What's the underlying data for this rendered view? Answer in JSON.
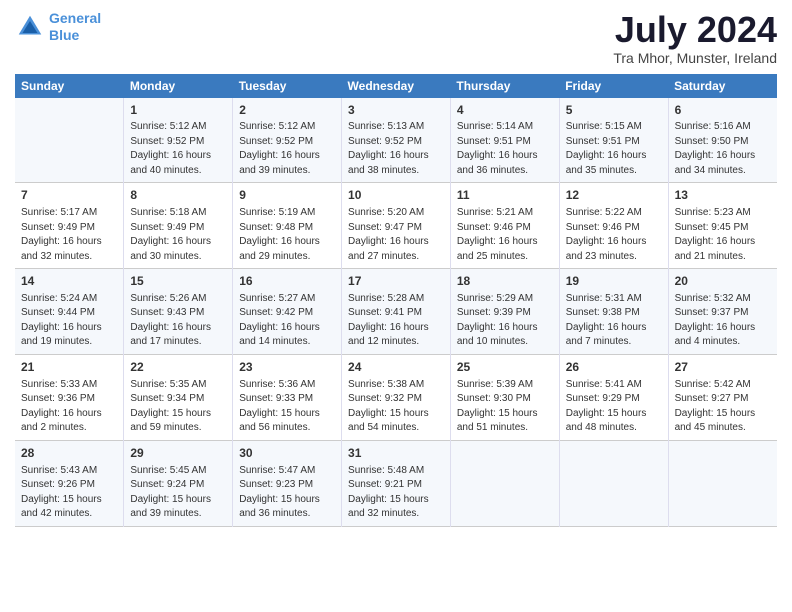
{
  "logo": {
    "line1": "General",
    "line2": "Blue"
  },
  "title": "July 2024",
  "subtitle": "Tra Mhor, Munster, Ireland",
  "days_header": [
    "Sunday",
    "Monday",
    "Tuesday",
    "Wednesday",
    "Thursday",
    "Friday",
    "Saturday"
  ],
  "weeks": [
    [
      {
        "day": "",
        "info": ""
      },
      {
        "day": "1",
        "info": "Sunrise: 5:12 AM\nSunset: 9:52 PM\nDaylight: 16 hours\nand 40 minutes."
      },
      {
        "day": "2",
        "info": "Sunrise: 5:12 AM\nSunset: 9:52 PM\nDaylight: 16 hours\nand 39 minutes."
      },
      {
        "day": "3",
        "info": "Sunrise: 5:13 AM\nSunset: 9:52 PM\nDaylight: 16 hours\nand 38 minutes."
      },
      {
        "day": "4",
        "info": "Sunrise: 5:14 AM\nSunset: 9:51 PM\nDaylight: 16 hours\nand 36 minutes."
      },
      {
        "day": "5",
        "info": "Sunrise: 5:15 AM\nSunset: 9:51 PM\nDaylight: 16 hours\nand 35 minutes."
      },
      {
        "day": "6",
        "info": "Sunrise: 5:16 AM\nSunset: 9:50 PM\nDaylight: 16 hours\nand 34 minutes."
      }
    ],
    [
      {
        "day": "7",
        "info": "Sunrise: 5:17 AM\nSunset: 9:49 PM\nDaylight: 16 hours\nand 32 minutes."
      },
      {
        "day": "8",
        "info": "Sunrise: 5:18 AM\nSunset: 9:49 PM\nDaylight: 16 hours\nand 30 minutes."
      },
      {
        "day": "9",
        "info": "Sunrise: 5:19 AM\nSunset: 9:48 PM\nDaylight: 16 hours\nand 29 minutes."
      },
      {
        "day": "10",
        "info": "Sunrise: 5:20 AM\nSunset: 9:47 PM\nDaylight: 16 hours\nand 27 minutes."
      },
      {
        "day": "11",
        "info": "Sunrise: 5:21 AM\nSunset: 9:46 PM\nDaylight: 16 hours\nand 25 minutes."
      },
      {
        "day": "12",
        "info": "Sunrise: 5:22 AM\nSunset: 9:46 PM\nDaylight: 16 hours\nand 23 minutes."
      },
      {
        "day": "13",
        "info": "Sunrise: 5:23 AM\nSunset: 9:45 PM\nDaylight: 16 hours\nand 21 minutes."
      }
    ],
    [
      {
        "day": "14",
        "info": "Sunrise: 5:24 AM\nSunset: 9:44 PM\nDaylight: 16 hours\nand 19 minutes."
      },
      {
        "day": "15",
        "info": "Sunrise: 5:26 AM\nSunset: 9:43 PM\nDaylight: 16 hours\nand 17 minutes."
      },
      {
        "day": "16",
        "info": "Sunrise: 5:27 AM\nSunset: 9:42 PM\nDaylight: 16 hours\nand 14 minutes."
      },
      {
        "day": "17",
        "info": "Sunrise: 5:28 AM\nSunset: 9:41 PM\nDaylight: 16 hours\nand 12 minutes."
      },
      {
        "day": "18",
        "info": "Sunrise: 5:29 AM\nSunset: 9:39 PM\nDaylight: 16 hours\nand 10 minutes."
      },
      {
        "day": "19",
        "info": "Sunrise: 5:31 AM\nSunset: 9:38 PM\nDaylight: 16 hours\nand 7 minutes."
      },
      {
        "day": "20",
        "info": "Sunrise: 5:32 AM\nSunset: 9:37 PM\nDaylight: 16 hours\nand 4 minutes."
      }
    ],
    [
      {
        "day": "21",
        "info": "Sunrise: 5:33 AM\nSunset: 9:36 PM\nDaylight: 16 hours\nand 2 minutes."
      },
      {
        "day": "22",
        "info": "Sunrise: 5:35 AM\nSunset: 9:34 PM\nDaylight: 15 hours\nand 59 minutes."
      },
      {
        "day": "23",
        "info": "Sunrise: 5:36 AM\nSunset: 9:33 PM\nDaylight: 15 hours\nand 56 minutes."
      },
      {
        "day": "24",
        "info": "Sunrise: 5:38 AM\nSunset: 9:32 PM\nDaylight: 15 hours\nand 54 minutes."
      },
      {
        "day": "25",
        "info": "Sunrise: 5:39 AM\nSunset: 9:30 PM\nDaylight: 15 hours\nand 51 minutes."
      },
      {
        "day": "26",
        "info": "Sunrise: 5:41 AM\nSunset: 9:29 PM\nDaylight: 15 hours\nand 48 minutes."
      },
      {
        "day": "27",
        "info": "Sunrise: 5:42 AM\nSunset: 9:27 PM\nDaylight: 15 hours\nand 45 minutes."
      }
    ],
    [
      {
        "day": "28",
        "info": "Sunrise: 5:43 AM\nSunset: 9:26 PM\nDaylight: 15 hours\nand 42 minutes."
      },
      {
        "day": "29",
        "info": "Sunrise: 5:45 AM\nSunset: 9:24 PM\nDaylight: 15 hours\nand 39 minutes."
      },
      {
        "day": "30",
        "info": "Sunrise: 5:47 AM\nSunset: 9:23 PM\nDaylight: 15 hours\nand 36 minutes."
      },
      {
        "day": "31",
        "info": "Sunrise: 5:48 AM\nSunset: 9:21 PM\nDaylight: 15 hours\nand 32 minutes."
      },
      {
        "day": "",
        "info": ""
      },
      {
        "day": "",
        "info": ""
      },
      {
        "day": "",
        "info": ""
      }
    ]
  ]
}
